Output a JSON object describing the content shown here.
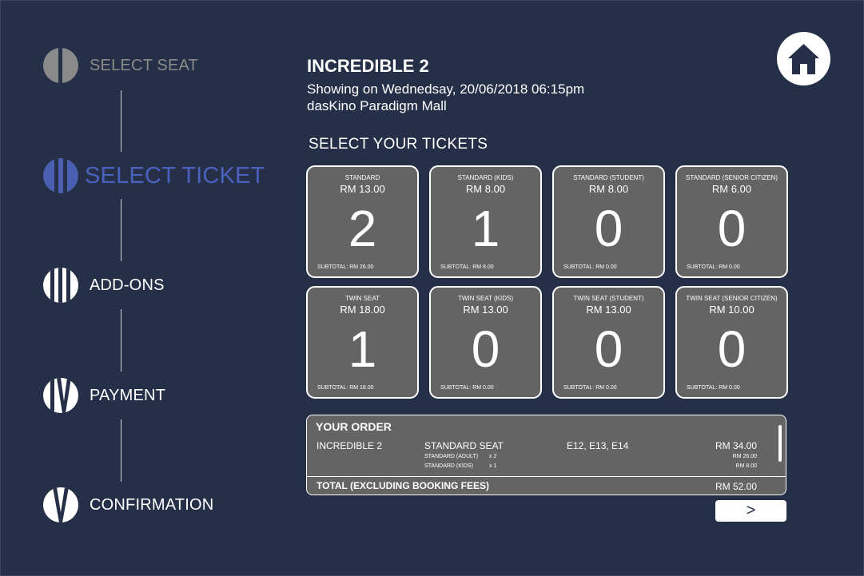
{
  "steps": [
    {
      "label": "SELECT SEAT",
      "state": "done"
    },
    {
      "label": "SELECT TICKET",
      "state": "active"
    },
    {
      "label": "ADD-ONS",
      "state": "todo"
    },
    {
      "label": "PAYMENT",
      "state": "todo"
    },
    {
      "label": "CONFIRMATION",
      "state": "todo"
    }
  ],
  "movie": {
    "title": "INCREDIBLE 2",
    "showing": "Showing on Wednedsay, 20/06/2018  06:15pm",
    "venue": "dasKino Paradigm Mall"
  },
  "section_title": "SELECT YOUR TICKETS",
  "tickets": [
    {
      "name": "STANDARD",
      "price": "RM 13.00",
      "qty": "2",
      "subtotal": "SUBTOTAL: RM 26.00"
    },
    {
      "name": "STANDARD (KIDS)",
      "price": "RM 8.00",
      "qty": "1",
      "subtotal": "SUBTOTAL: RM 8.00"
    },
    {
      "name": "STANDARD (STUDENT)",
      "price": "RM 8.00",
      "qty": "0",
      "subtotal": "SUBTOTAL: RM 0.00"
    },
    {
      "name": "STANDARD (SENIOR CITIZEN)",
      "price": "RM 6.00",
      "qty": "0",
      "subtotal": "SUBTOTAL: RM 0.00"
    },
    {
      "name": "TWIN SEAT",
      "price": "RM 18.00",
      "qty": "1",
      "subtotal": "SUBTOTAL: RM 18.00"
    },
    {
      "name": "TWIN SEAT (KIDS)",
      "price": "RM 13.00",
      "qty": "0",
      "subtotal": "SUBTOTAL: RM 0.00"
    },
    {
      "name": "TWIN SEAT (STUDENT)",
      "price": "RM 13.00",
      "qty": "0",
      "subtotal": "SUBTOTAL: RM 0.00"
    },
    {
      "name": "TWIN SEAT (SENIOR CITIZEN)",
      "price": "RM 10.00",
      "qty": "0",
      "subtotal": "SUBTOTAL: RM 0.00"
    }
  ],
  "order": {
    "heading": "YOUR ORDER",
    "movie": "INCREDIBLE 2",
    "seat_type": "STANDARD SEAT",
    "seats": "E12, E13, E14",
    "amount": "RM 34.00",
    "details": [
      {
        "label": "STANDARD (ADULT)",
        "qty": "x 2",
        "price": "RM 26.00"
      },
      {
        "label": "STANDARD (KIDS)",
        "qty": "x 1",
        "price": "RM 8.00"
      }
    ],
    "total_label": "TOTAL (EXCLUDING BOOKING FEES)",
    "total_value": "RM 52.00"
  },
  "next_label": ">",
  "icons": {
    "home": "home-icon"
  },
  "colors": {
    "background": "#252f47",
    "active": "#4a62bd",
    "done": "#8a8a8a",
    "card": "#646464"
  }
}
